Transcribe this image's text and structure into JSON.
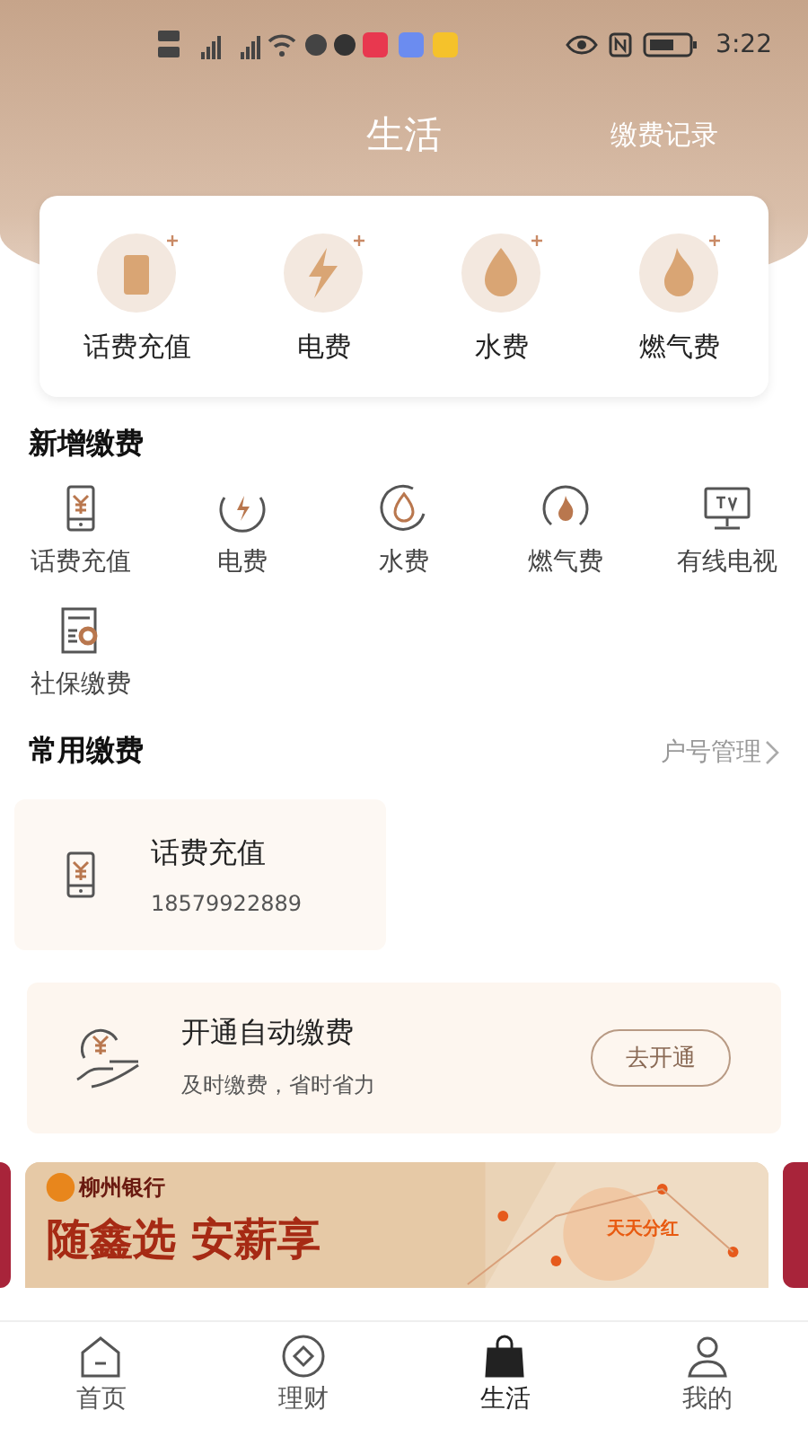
{
  "status_bar": {
    "time": "3:22"
  },
  "header": {
    "title": "生活",
    "action": "缴费记录"
  },
  "featured": [
    {
      "kind": "phone",
      "label": "话费充值"
    },
    {
      "kind": "power",
      "label": "电费"
    },
    {
      "kind": "water",
      "label": "水费"
    },
    {
      "kind": "gas",
      "label": "燃气费"
    }
  ],
  "new_payment": {
    "title": "新增缴费",
    "items": [
      {
        "kind": "phone",
        "label": "话费充值"
      },
      {
        "kind": "power",
        "label": "电费"
      },
      {
        "kind": "water",
        "label": "水费"
      },
      {
        "kind": "gas",
        "label": "燃气费"
      },
      {
        "kind": "tv",
        "label": "有线电视"
      },
      {
        "kind": "social",
        "label": "社保缴费"
      }
    ]
  },
  "common_payment": {
    "title": "常用缴费",
    "manage_link": "户号管理",
    "items": [
      {
        "kind": "phone",
        "name": "话费充值",
        "account": "18579922889"
      }
    ]
  },
  "auto_pay": {
    "title": "开通自动缴费",
    "subtitle": "及时缴费，省时省力",
    "button": "去开通"
  },
  "banner": {
    "bank": "柳州银行",
    "headline": "随鑫选 安薪享",
    "tag": "天天分红"
  },
  "tab_bar": [
    {
      "kind": "home",
      "label": "首页",
      "selected": false
    },
    {
      "kind": "wealth",
      "label": "理财",
      "selected": false
    },
    {
      "kind": "life",
      "label": "生活",
      "selected": true
    },
    {
      "kind": "me",
      "label": "我的",
      "selected": false
    }
  ]
}
